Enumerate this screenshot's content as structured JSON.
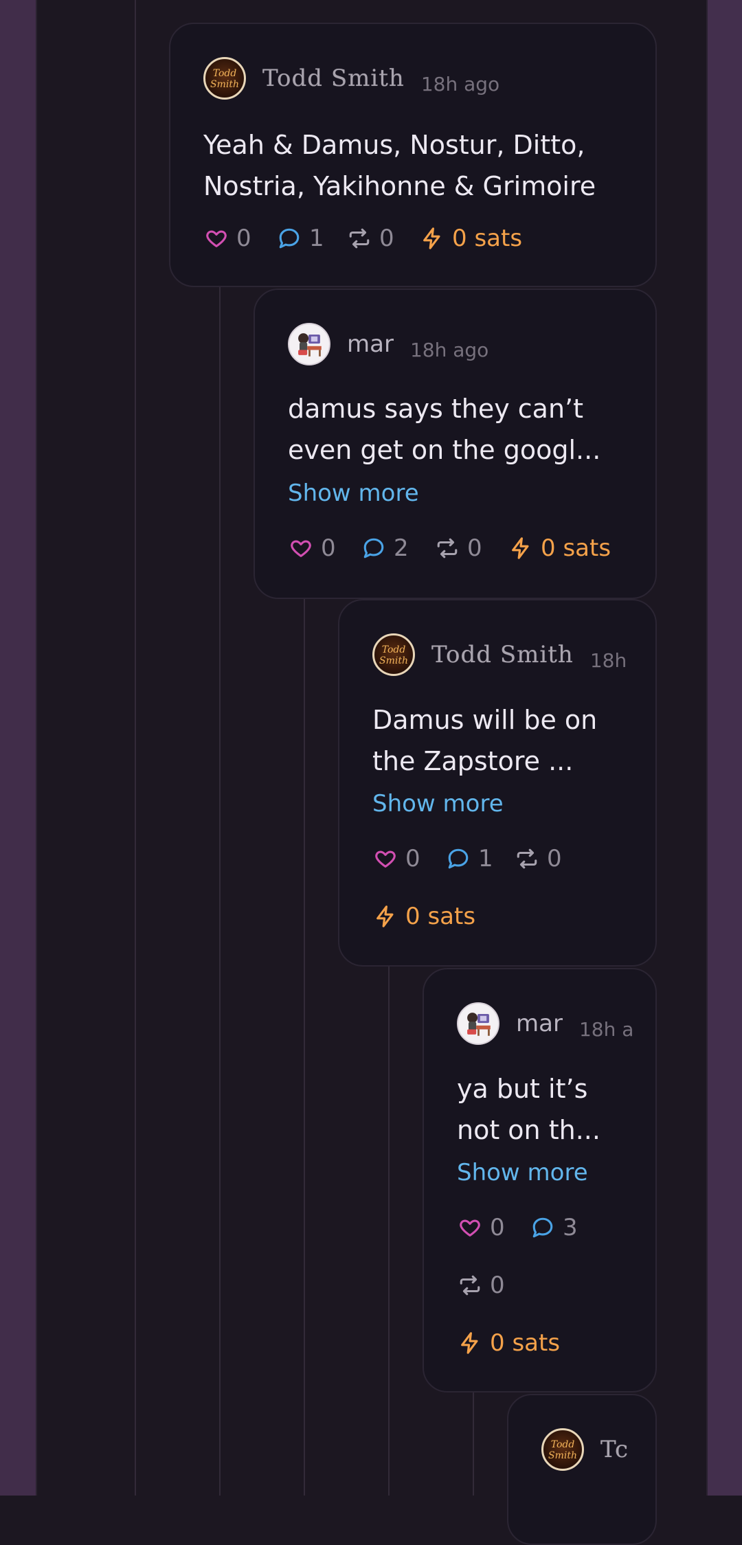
{
  "colors": {
    "like": "#d24fb2",
    "reply": "#4aa3e6",
    "zap": "#f5a24a",
    "link": "#62b6ec",
    "background": "#1c1721",
    "sidebar": "#412d4a"
  },
  "icons": {
    "like": "heart-icon",
    "reply": "comment-icon",
    "repost": "repost-icon",
    "zap": "lightning-icon"
  },
  "posts": [
    {
      "author": "Todd Smith",
      "time": "18h ago",
      "lines": [
        "Yeah & Damus, Nostur, Ditto,",
        "Nostria, Yakihonne & Grimoire"
      ],
      "likes": "0",
      "replies": "1",
      "reposts": "0",
      "zaps": "0 sats"
    },
    {
      "author": "mar",
      "time": "18h ago",
      "lines": [
        "damus says they can’t",
        "even get on the googl..."
      ],
      "show_more": "Show more",
      "likes": "0",
      "replies": "2",
      "reposts": "0",
      "zaps": "0 sats"
    },
    {
      "author": "Todd Smith",
      "time": "18h",
      "lines": [
        "Damus will be on",
        "the Zapstore ..."
      ],
      "show_more": "Show more",
      "likes": "0",
      "replies": "1",
      "reposts": "0",
      "zaps": "0 sats"
    },
    {
      "author": "mar",
      "time": "18h a",
      "lines": [
        "ya but it’s",
        "not on th..."
      ],
      "show_more": "Show more",
      "likes": "0",
      "replies": "3",
      "reposts": "0",
      "zaps": "0 sats"
    },
    {
      "author": "Tc"
    }
  ]
}
